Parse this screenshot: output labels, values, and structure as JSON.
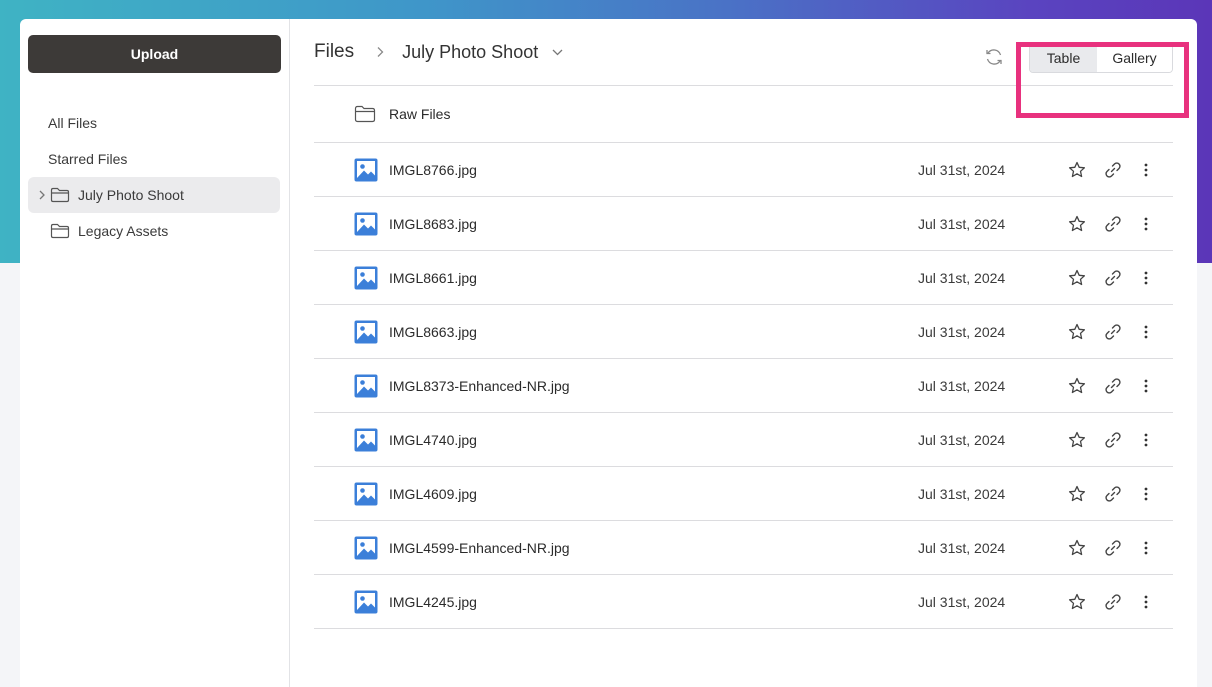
{
  "sidebar": {
    "upload_label": "Upload",
    "items": [
      {
        "label": "All Files"
      },
      {
        "label": "Starred Files"
      },
      {
        "label": "July Photo Shoot"
      },
      {
        "label": "Legacy Assets"
      }
    ]
  },
  "header": {
    "root": "Files",
    "current": "July Photo Shoot",
    "views": {
      "table": "Table",
      "gallery": "Gallery"
    }
  },
  "folders": [
    {
      "name": "Raw Files"
    }
  ],
  "files": [
    {
      "name": "IMGL8766.jpg",
      "date": "Jul 31st, 2024"
    },
    {
      "name": "IMGL8683.jpg",
      "date": "Jul 31st, 2024"
    },
    {
      "name": "IMGL8661.jpg",
      "date": "Jul 31st, 2024"
    },
    {
      "name": "IMGL8663.jpg",
      "date": "Jul 31st, 2024"
    },
    {
      "name": "IMGL8373-Enhanced-NR.jpg",
      "date": "Jul 31st, 2024"
    },
    {
      "name": "IMGL4740.jpg",
      "date": "Jul 31st, 2024"
    },
    {
      "name": "IMGL4609.jpg",
      "date": "Jul 31st, 2024"
    },
    {
      "name": "IMGL4599-Enhanced-NR.jpg",
      "date": "Jul 31st, 2024"
    },
    {
      "name": "IMGL4245.jpg",
      "date": "Jul 31st, 2024"
    }
  ],
  "colors": {
    "accent_highlight": "#e8317e",
    "image_icon": "#3b7fd9",
    "upload_button": "#3d3a38"
  }
}
